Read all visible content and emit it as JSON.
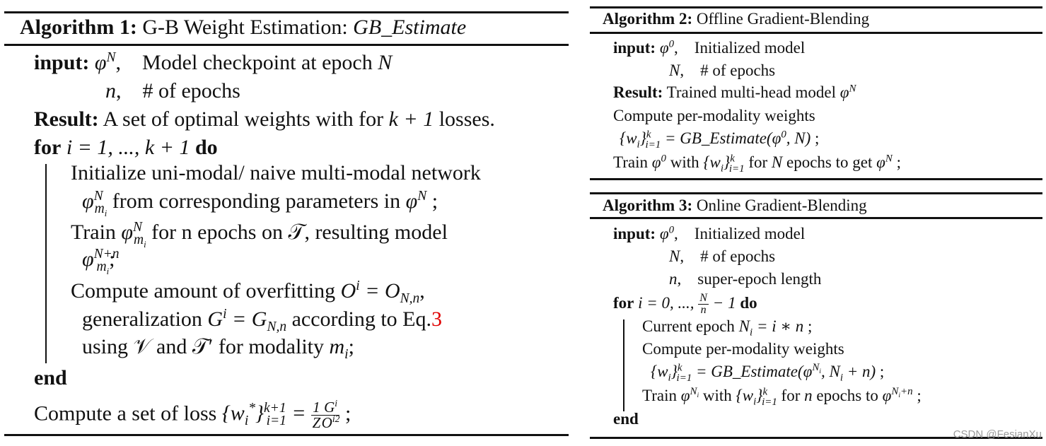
{
  "algorithm1": {
    "label": "Algorithm 1:",
    "title": "G-B Weight Estimation:",
    "title_func": "GB_Estimate",
    "input_label": "input:",
    "inputs": [
      {
        "symbol": "φ",
        "sup": "N",
        "desc": "Model checkpoint at epoch",
        "desc_math": "N"
      },
      {
        "symbol": "n",
        "desc": "# of epochs"
      }
    ],
    "result_label": "Result:",
    "result_text": "A set of optimal weights with for",
    "result_math": "k + 1",
    "result_tail": "losses.",
    "for_kw": "for",
    "for_expr": "i = 1, ..., k + 1",
    "do_kw": "do",
    "body": [
      "Initialize uni-modal/ naive multi-modal network",
      "from corresponding parameters in",
      "Train",
      "for n epochs on 𝒯, resulting model",
      "Compute amount of overfitting",
      "generalization",
      "according to Eq.",
      "using 𝒱 and 𝒯′ for modality"
    ],
    "eq_ref": "3",
    "end_kw": "end",
    "final": "Compute a set of loss"
  },
  "algorithm2": {
    "label": "Algorithm 2:",
    "title": "Offline Gradient-Blending",
    "input_label": "input:",
    "inputs": [
      {
        "symbol": "φ",
        "sup": "0",
        "desc": "Initialized model"
      },
      {
        "symbol": "N",
        "desc": "# of epochs"
      }
    ],
    "result_label": "Result:",
    "result_text": "Trained multi-head model",
    "lines": [
      "Compute per-modality weights",
      "Train",
      "with",
      "for",
      "epochs to get"
    ]
  },
  "algorithm3": {
    "label": "Algorithm 3:",
    "title": "Online Gradient-Blending",
    "input_label": "input:",
    "inputs": [
      {
        "symbol": "φ",
        "sup": "0",
        "desc": "Initialized model"
      },
      {
        "symbol": "N",
        "desc": "# of epochs"
      },
      {
        "symbol": "n",
        "desc": "super-epoch length"
      }
    ],
    "for_kw": "for",
    "do_kw": "do",
    "lines": [
      "Current epoch",
      "Compute per-modality weights",
      "Train",
      "with",
      "for",
      "epochs to"
    ],
    "end_kw": "end"
  },
  "watermark": "CSDN @FesianXu"
}
